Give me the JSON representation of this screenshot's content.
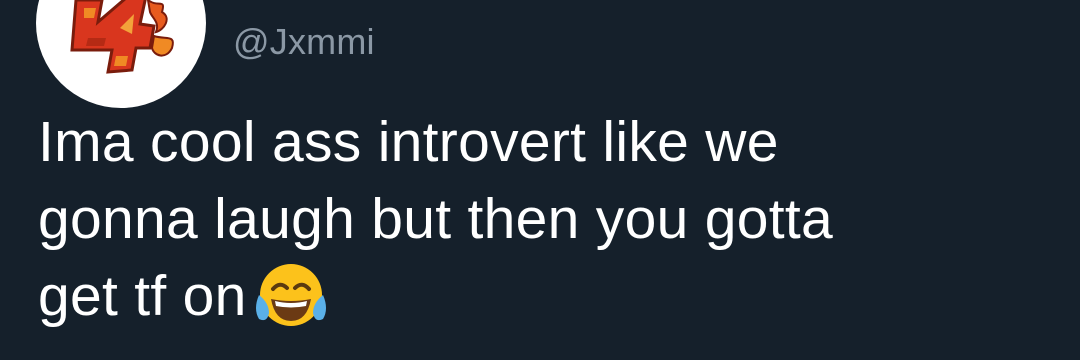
{
  "tweet": {
    "handle": "@Jxmmi",
    "text_line_1": "Ima cool ass introvert like we",
    "text_line_2": "gonna laugh but then you gotta",
    "text_line_3": "get tf on",
    "emoji": "face-with-tears-of-joy"
  },
  "colors": {
    "background": "#15202b",
    "text": "#ffffff",
    "handle": "#8b98a5",
    "avatar_bg": "#ffffff"
  }
}
